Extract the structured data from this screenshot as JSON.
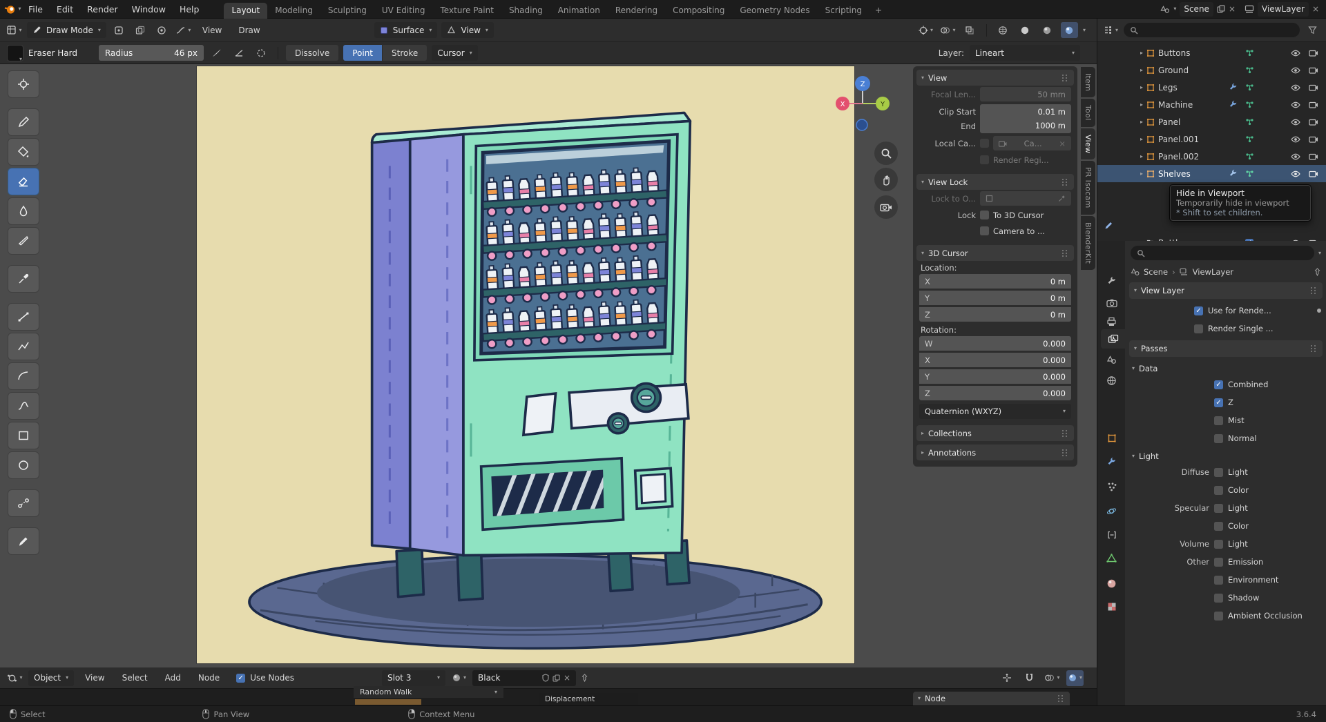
{
  "topbar": {
    "menus": [
      "File",
      "Edit",
      "Render",
      "Window",
      "Help"
    ],
    "workspaces": [
      "Layout",
      "Modeling",
      "Sculpting",
      "UV Editing",
      "Texture Paint",
      "Shading",
      "Animation",
      "Rendering",
      "Compositing",
      "Geometry Nodes",
      "Scripting"
    ],
    "add_workspace": "+",
    "scene": "Scene",
    "viewlayer": "ViewLayer"
  },
  "viewport_header": {
    "mode": "Draw Mode",
    "menu_view": "View",
    "menu_draw": "Draw",
    "placement": "Surface",
    "drawing_plane": "View"
  },
  "tool_settings": {
    "brush": "Eraser Hard",
    "radius_label": "Radius",
    "radius_value": "46 px",
    "dissolve": "Dissolve",
    "point": "Point",
    "stroke": "Stroke",
    "cursor": "Cursor",
    "layer_label": "Layer:",
    "layer": "Lineart"
  },
  "sidebar_tabs": {
    "item": "Item",
    "tool": "Tool",
    "view": "View",
    "pr_isocam": "PR Isocam",
    "blenderkit": "BlenderKit"
  },
  "axis_gizmo": {
    "x": "X",
    "y": "Y",
    "z": "Z"
  },
  "n_panel": {
    "view": {
      "title": "View",
      "focal_label": "Focal Len...",
      "focal_value": "50 mm",
      "clip_start_label": "Clip Start",
      "clip_start_value": "0.01 m",
      "clip_end_label": "End",
      "clip_end_value": "1000 m",
      "local_camera_label": "Local Ca...",
      "local_camera_value": "Ca...",
      "render_region_label": "Render Regi..."
    },
    "view_lock": {
      "title": "View Lock",
      "lock_to_object": "Lock to O...",
      "lock": "Lock",
      "to_3d_cursor": "To 3D Cursor",
      "camera_to_view": "Camera to ..."
    },
    "cursor_3d": {
      "title": "3D Cursor",
      "location_label": "Location:",
      "location": [
        {
          "axis": "X",
          "value": "0 m"
        },
        {
          "axis": "Y",
          "value": "0 m"
        },
        {
          "axis": "Z",
          "value": "0 m"
        }
      ],
      "rotation_label": "Rotation:",
      "rotation": [
        {
          "axis": "W",
          "value": "0.000"
        },
        {
          "axis": "X",
          "value": "0.000"
        },
        {
          "axis": "Y",
          "value": "0.000"
        },
        {
          "axis": "Z",
          "value": "0.000"
        }
      ],
      "rotation_mode": "Quaternion (WXYZ)"
    },
    "collections": "Collections",
    "annotations": "Annotations"
  },
  "outliner": {
    "rows": [
      {
        "name": "Buttons",
        "selected": false
      },
      {
        "name": "Ground",
        "selected": false
      },
      {
        "name": "Legs",
        "selected": false
      },
      {
        "name": "Machine",
        "selected": false
      },
      {
        "name": "Panel",
        "selected": false
      },
      {
        "name": "Panel.001",
        "selected": false
      },
      {
        "name": "Panel.002",
        "selected": false
      },
      {
        "name": "Shelves",
        "selected": true
      },
      {
        "name": "Bottles",
        "selected": false
      }
    ]
  },
  "tooltip": {
    "title": "Hide in Viewport",
    "description": "Temporarily hide in viewport",
    "shortcut_hint": "* Shift to set children."
  },
  "properties": {
    "breadcrumb_scene": "Scene",
    "breadcrumb_viewlayer": "ViewLayer",
    "view_layer": {
      "title": "View Layer",
      "use_for_rendering": "Use for Rende...",
      "render_single_layer": "Render Single ..."
    },
    "passes": {
      "title": "Passes",
      "data_title": "Data",
      "data_items": [
        {
          "label": "Combined",
          "checked": true
        },
        {
          "label": "Z",
          "checked": true
        },
        {
          "label": "Mist",
          "checked": false
        },
        {
          "label": "Normal",
          "checked": false
        }
      ],
      "light_title": "Light",
      "light_r": [
        {
          "group": "Diffuse",
          "label": "Light",
          "checked": false
        },
        {
          "group": "",
          "label": "Color",
          "checked": false
        },
        {
          "group": "Specular",
          "label": "Light",
          "checked": false
        },
        {
          "group": "",
          "label": "Color",
          "checked": false
        },
        {
          "group": "Volume",
          "label": "Light",
          "checked": false
        },
        {
          "group": "Other",
          "label": "Emission",
          "checked": false
        },
        {
          "group": "",
          "label": "Environment",
          "checked": false
        },
        {
          "group": "",
          "label": "Shadow",
          "checked": false
        },
        {
          "group": "",
          "label": "Ambient Occlusion",
          "checked": false
        }
      ]
    }
  },
  "shader_editor": {
    "object_mode": "Object",
    "menus": [
      "View",
      "Select",
      "Add",
      "Node"
    ],
    "use_nodes": "Use Nodes",
    "slot": "Slot 3",
    "material": "Black",
    "fragment_random_walk": "Random Walk",
    "fragment_displacement": "Displacement",
    "node_panel": "Node"
  },
  "status_bar": {
    "select": "Select",
    "pan_view": "Pan View",
    "context_menu": "Context Menu",
    "version": "3.6.4"
  }
}
